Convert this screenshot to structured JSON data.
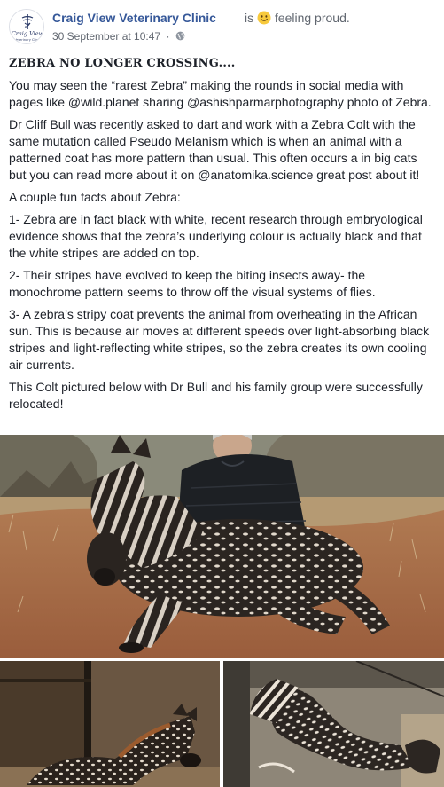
{
  "post": {
    "author": "Craig View Veterinary Clinic",
    "activity_prefix": "is",
    "activity_icon": "smiling-face-icon",
    "activity_text": "feeling proud.",
    "timestamp": "30 September at 10:47",
    "separator": "·",
    "privacy_icon": "globe-icon",
    "avatar_lines": [
      "Craig View",
      "Veterinary Clinic"
    ]
  },
  "body": {
    "headline": "ZEBRA NO LONGER CROSSING....",
    "paragraphs": [
      "You may seen the “rarest Zebra” making the rounds in social media with pages like @wild.planet sharing @ashishparmarphotography photo of Zebra.",
      "Dr Cliff Bull was recently asked to dart and work with a Zebra Colt with the same mutation called Pseudo Melanism which is when an animal with a patterned coat has more pattern than usual. This often occurs a in big cats but you can read more about it on @anatomika.science great post about it!",
      "A couple fun facts about Zebra:",
      "1- Zebra are in fact black with white, recent research through embryological evidence shows that the zebra’s underlying colour is actually black and that the white stripes are added on top.",
      "2- Their stripes have evolved to keep the biting insects away- the monochrome pattern seems to throw off the visual systems of flies.",
      "3- A zebra’s stripy coat prevents the animal from overheating in the African sun. This is because air moves at different speeds over light-absorbing black stripes and light-reflecting white stripes, so the zebra creates its own cooling air currents.",
      "This Colt pictured below with Dr Bull and his family group were successfully relocated!"
    ]
  },
  "colors": {
    "link": "#365899",
    "text": "#1d2129",
    "meta": "#616770"
  }
}
